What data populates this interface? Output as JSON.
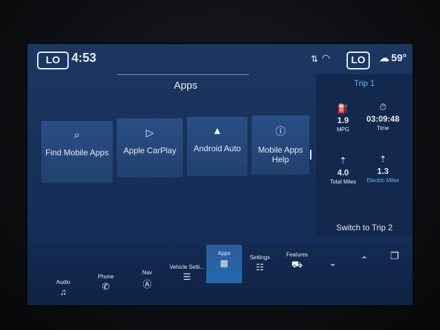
{
  "status": {
    "left_temp_mode": "LO",
    "time": "4:53",
    "right_temp_mode": "LO",
    "outside_temp": "59°",
    "icons": [
      "signal-icon",
      "wifi-icon",
      "outside-temp-icon"
    ]
  },
  "apps": {
    "title": "Apps",
    "tiles": [
      {
        "label": "Find Mobile Apps",
        "icon": "find-apps-icon"
      },
      {
        "label": "Apple CarPlay",
        "icon": "carplay-icon"
      },
      {
        "label": "Android Auto",
        "icon": "android-auto-icon"
      },
      {
        "label": "Mobile Apps Help",
        "icon": "help-icon"
      }
    ]
  },
  "trip": {
    "title": "Trip 1",
    "stats": [
      {
        "value": "1.9",
        "label": "MPG",
        "icon": "fuel-efficiency-icon"
      },
      {
        "value": "03:09:48",
        "label": "Time",
        "icon": "stopwatch-icon"
      },
      {
        "value": "4.0",
        "label": "Total Miles",
        "icon": "road-icon"
      },
      {
        "value": "1.3",
        "label": "Electric Miles",
        "icon": "electric-road-icon"
      }
    ],
    "switch_label": "Switch to Trip 2"
  },
  "nav": {
    "audio": "Audio",
    "phone": "Phone",
    "nav": "Nav",
    "vehicle": "Vehicle Setti...",
    "apps": "Apps",
    "settings": "Settings",
    "features": "Features"
  },
  "colors": {
    "accent": "#6fb4f0",
    "screen_bg": "#17305a",
    "active_tab": "#2468b2"
  }
}
